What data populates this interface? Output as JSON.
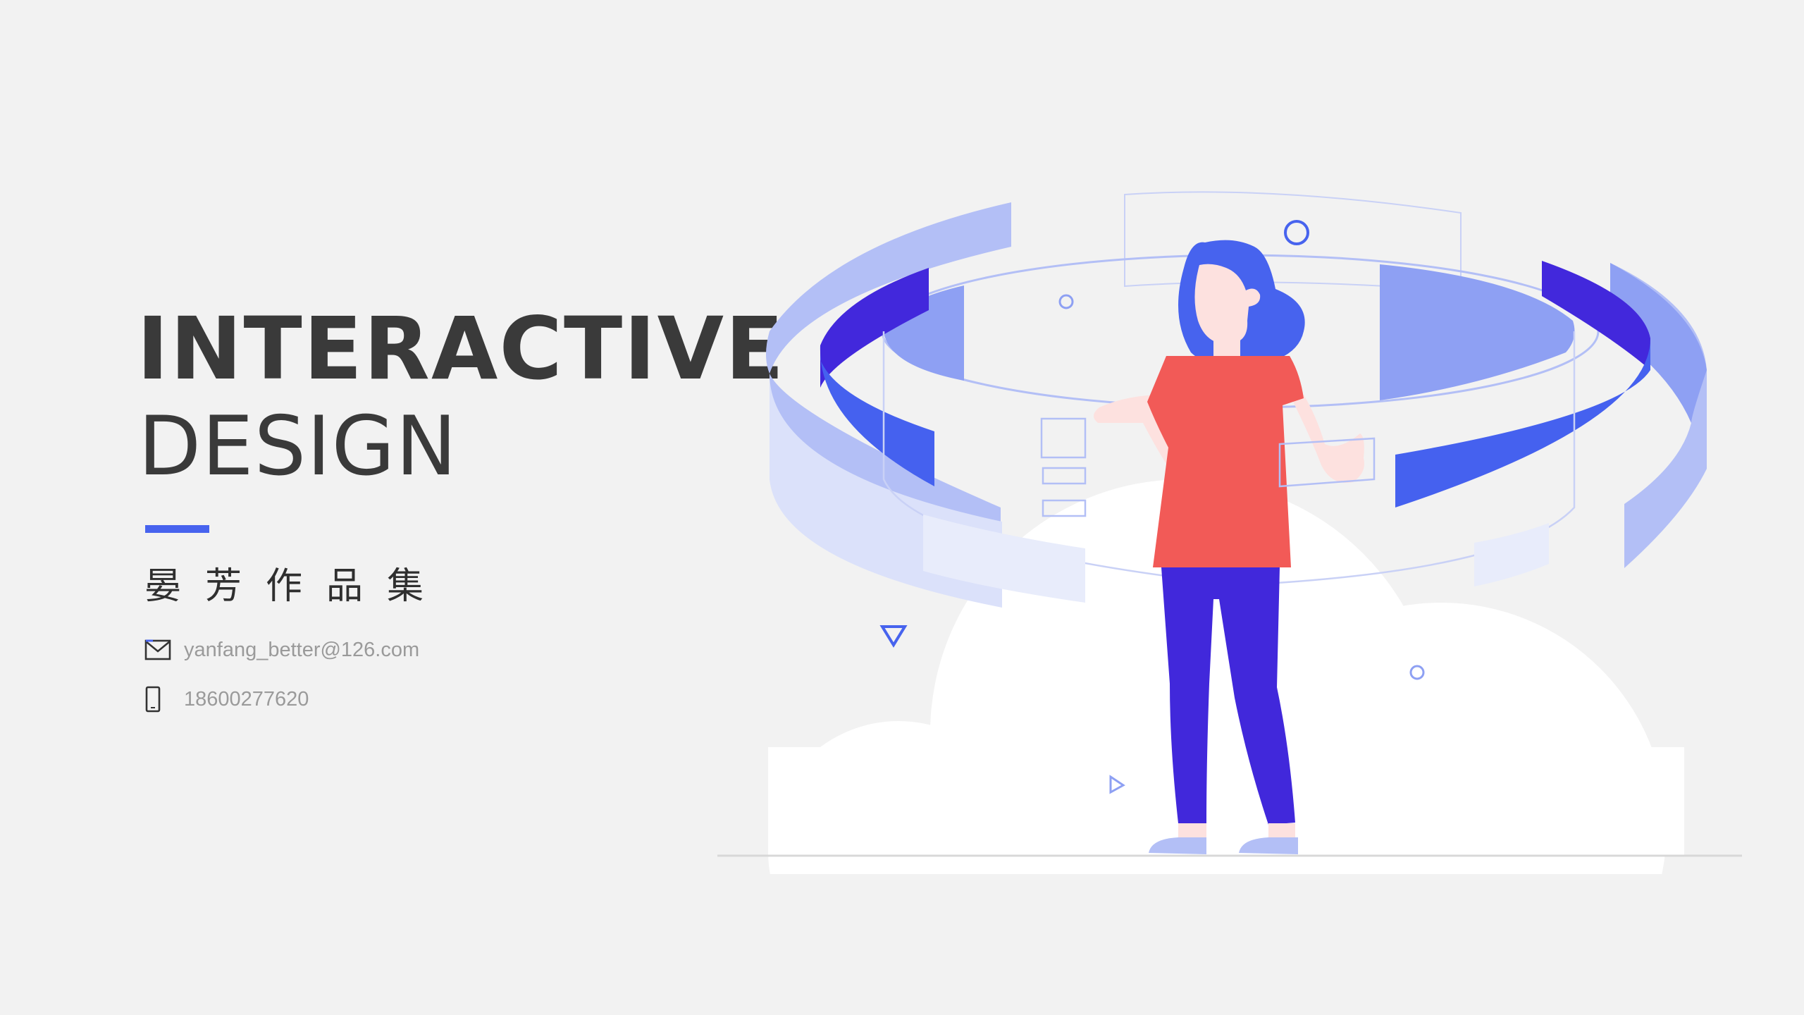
{
  "title": {
    "line1": "INTERACTIVE",
    "line2": "DESIGN"
  },
  "subtitle": "晏芳作品集",
  "contacts": {
    "email": {
      "icon": "mail-icon",
      "text": "yanfang_better@126.com"
    },
    "phone": {
      "icon": "phone-icon",
      "text": "18600277620"
    }
  },
  "colors": {
    "background": "#f2f2f2",
    "accent": "#4763ee",
    "title_text": "#3a3a3a",
    "contact_text": "#9a9a9a",
    "ring_light": "#b3bff6",
    "ring_mid": "#8ea0f3",
    "ring_dark": "#4228dc",
    "ring_blue": "#4561ef",
    "shirt": "#f25a57",
    "pants": "#4128db",
    "hair": "#4763ee",
    "skin": "#fde1df",
    "cloud": "#ffffff"
  }
}
